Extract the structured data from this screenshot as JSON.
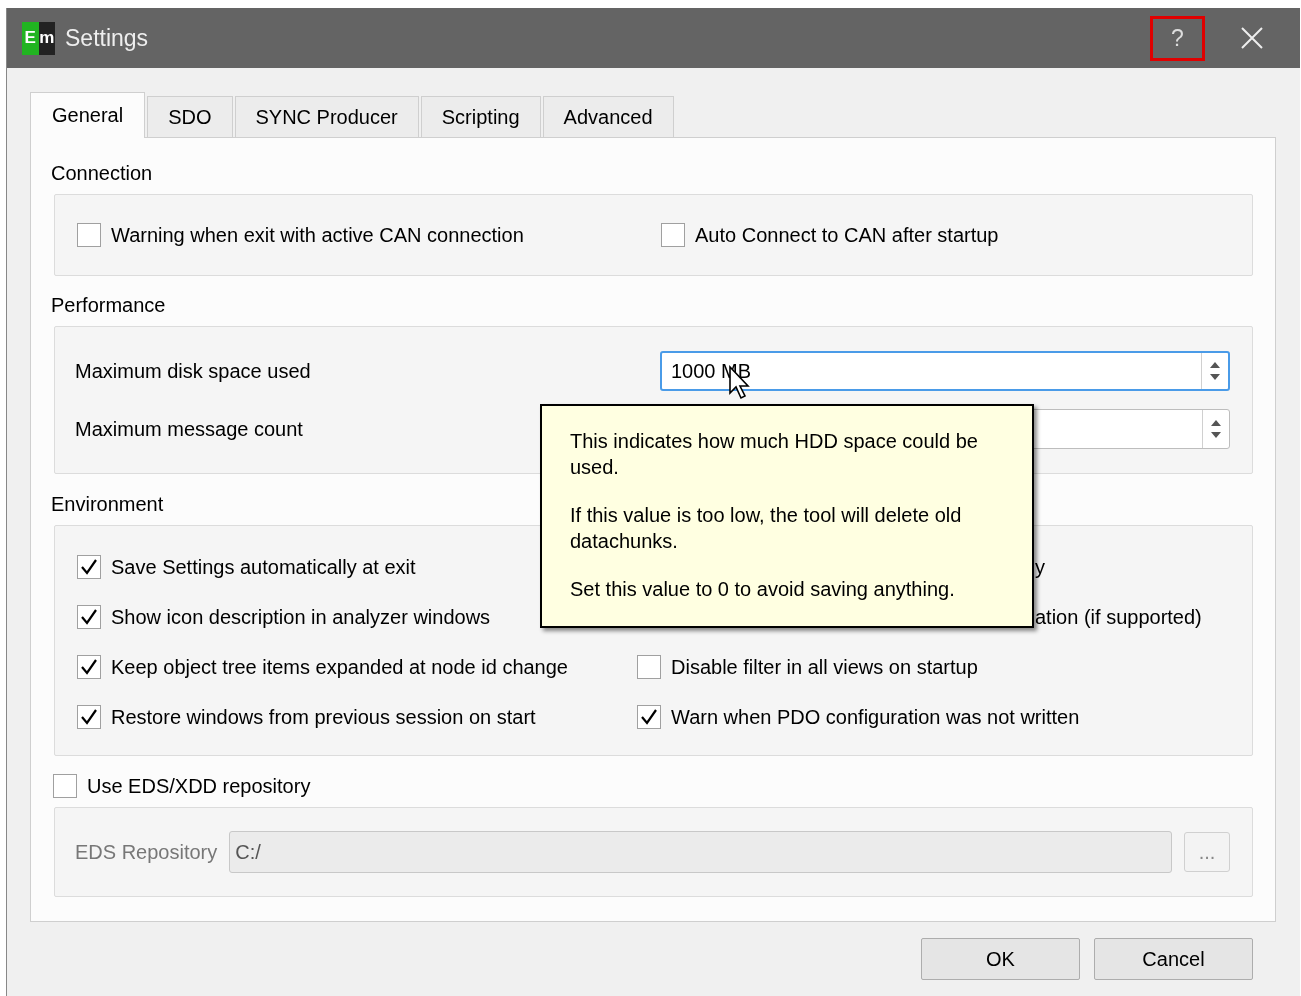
{
  "window": {
    "title": "Settings",
    "app_icon": [
      "E",
      "m"
    ],
    "help_button": {
      "label": "?",
      "highlighted": true
    }
  },
  "tabs": [
    {
      "label": "General",
      "selected": true
    },
    {
      "label": "SDO",
      "selected": false
    },
    {
      "label": "SYNC Producer",
      "selected": false
    },
    {
      "label": "Scripting",
      "selected": false
    },
    {
      "label": "Advanced",
      "selected": false
    }
  ],
  "connection": {
    "title": "Connection",
    "options": [
      {
        "kind": "checkbox",
        "label": "Warning when exit with active CAN connection",
        "checked": false
      },
      {
        "kind": "checkbox",
        "label": "Auto Connect to CAN after startup",
        "checked": false
      }
    ]
  },
  "performance": {
    "title": "Performance",
    "fields": [
      {
        "label": "Maximum disk space used",
        "value": "1000 MB",
        "focused": true
      },
      {
        "label": "Maximum message count",
        "focused": false
      }
    ]
  },
  "environment": {
    "title": "Environment",
    "options": [
      {
        "kind": "checkbox",
        "label": "Save Settings automatically at exit",
        "checked": true
      },
      {
        "kind": "partial",
        "label": "y"
      },
      {
        "kind": "checkbox",
        "label": "Show icon description in analyzer windows",
        "checked": true
      },
      {
        "kind": "partial",
        "label": "ation (if supported)"
      },
      {
        "kind": "checkbox",
        "label": "Keep object tree items expanded at node id change",
        "checked": true
      },
      {
        "kind": "checkbox",
        "label": "Disable filter in all views on startup",
        "checked": false
      },
      {
        "kind": "checkbox",
        "label": "Restore windows from previous session on start",
        "checked": true
      },
      {
        "kind": "checkbox",
        "label": "Warn when PDO configuration was not written",
        "checked": true
      }
    ]
  },
  "repository": {
    "label": "Use EDS/XDD repository",
    "checked": false,
    "field_label": "EDS Repository",
    "path": "C:/",
    "browse_label": "...",
    "disabled": true
  },
  "tooltip": {
    "paragraphs": [
      "This indicates how much HDD space could be used.",
      "If this value is too low, the tool will delete old datachunks.",
      "Set this value to 0 to avoid saving anything."
    ]
  },
  "buttons": [
    {
      "label": "OK"
    },
    {
      "label": "Cancel"
    }
  ]
}
